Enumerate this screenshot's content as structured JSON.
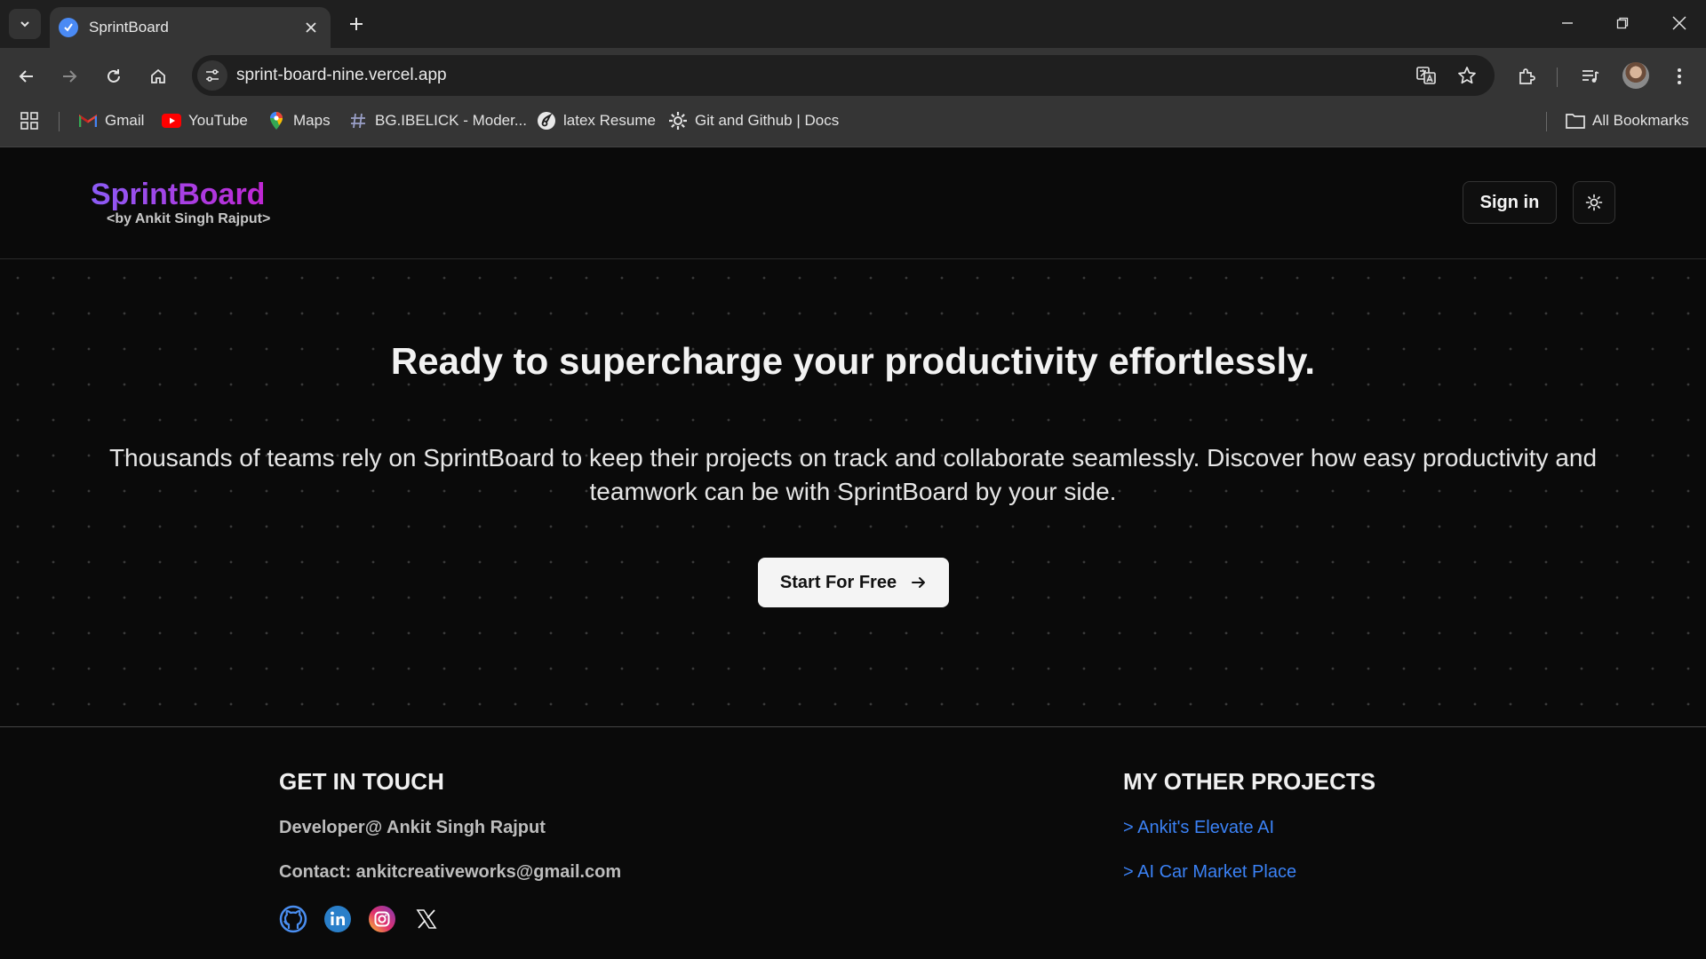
{
  "browser": {
    "tab_title": "SprintBoard",
    "url": "sprint-board-nine.vercel.app",
    "bookmarks": [
      {
        "label": "Gmail",
        "icon": "gmail-icon"
      },
      {
        "label": "YouTube",
        "icon": "youtube-icon"
      },
      {
        "label": "Maps",
        "icon": "maps-icon"
      },
      {
        "label": "BG.IBELICK - Moder...",
        "icon": "hash-icon"
      },
      {
        "label": "latex Resume",
        "icon": "overleaf-icon"
      },
      {
        "label": "Git and Github | Docs",
        "icon": "gear-icon"
      }
    ],
    "all_bookmarks": "All Bookmarks"
  },
  "header": {
    "logo": "SprintBoard",
    "logo_sub": "<by Ankit Singh Rajput>",
    "signin": "Sign in"
  },
  "hero": {
    "title": "Ready to supercharge your productivity effortlessly.",
    "description": "Thousands of teams rely on SprintBoard to keep their projects on track and collaborate seamlessly. Discover how easy productivity and teamwork can be with SprintBoard by your side.",
    "cta": "Start For Free"
  },
  "footer": {
    "contact_heading": "GET IN TOUCH",
    "developer": "Developer@ Ankit Singh Rajput",
    "contact": "Contact: ankitcreativeworks@gmail.com",
    "projects_heading": "MY OTHER PROJECTS",
    "projects": [
      "> Ankit's Elevate AI",
      "> AI Car Market Place"
    ],
    "socials": [
      "github-icon",
      "linkedin-icon",
      "instagram-icon",
      "x-icon"
    ]
  },
  "colors": {
    "brand_gradient_start": "#8b5cf6",
    "brand_gradient_end": "#c026d3",
    "link": "#3b82f6",
    "page_bg": "#0a0a0a"
  }
}
